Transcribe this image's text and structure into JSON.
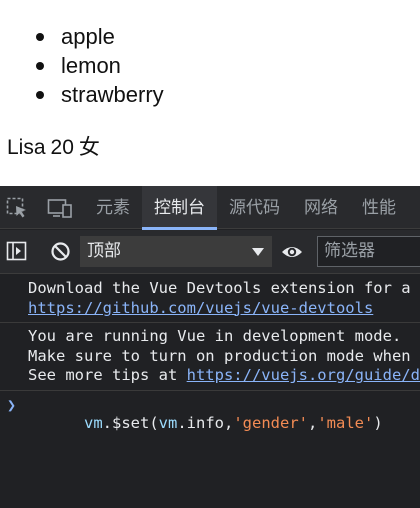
{
  "page": {
    "fruits": [
      "apple",
      "lemon",
      "strawberry"
    ],
    "person": {
      "name": "Lisa",
      "age": "20",
      "gender": "女"
    }
  },
  "devtools": {
    "tabs": [
      "元素",
      "控制台",
      "源代码",
      "网络",
      "性能"
    ],
    "active_tab": "控制台",
    "context": "顶部",
    "filter_placeholder": "筛选器",
    "accent_color": "#8ab4f8",
    "messages": [
      {
        "line1": "Download the Vue Devtools extension for a better development experience:",
        "link1": "https://github.com/vuejs/vue-devtools"
      },
      {
        "line1": "You are running Vue in development mode.",
        "line2": "Make sure to turn on production mode when deploying for production.",
        "line3_prefix": "See more tips at ",
        "link": "https://vuejs.org/guide/deployment.html"
      }
    ],
    "command": {
      "obj1": "vm",
      "method": ".$set(",
      "obj2": "vm",
      "prop": ".info,",
      "key": "'gender'",
      "comma": ",",
      "value": "'male'",
      "close": ")"
    }
  }
}
